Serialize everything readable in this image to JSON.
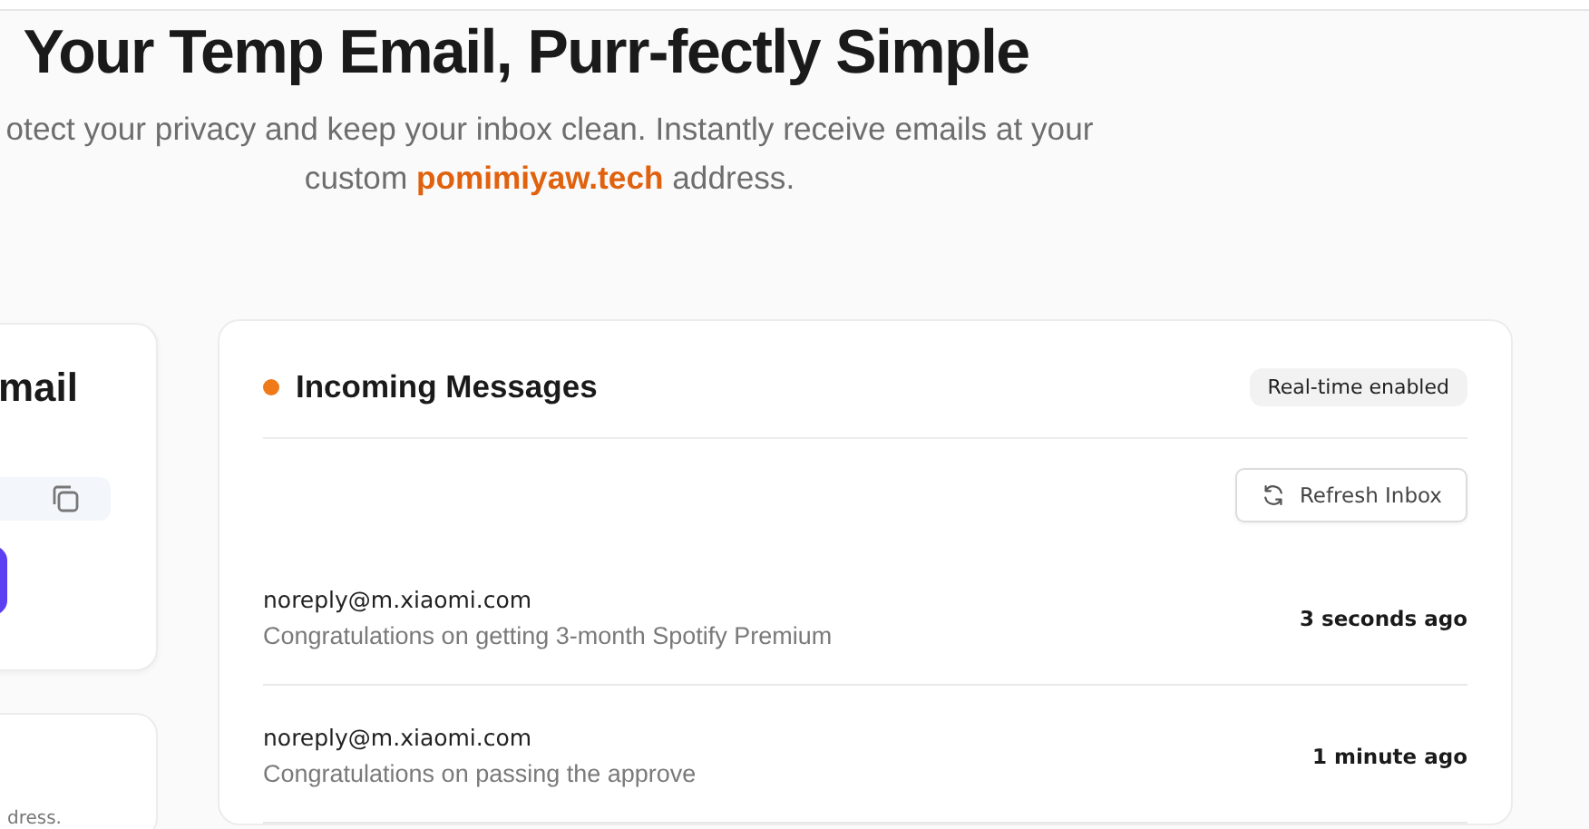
{
  "hero": {
    "title": "Your Temp Email, Purr-fectly Simple",
    "subtitle": "otect your privacy and keep your inbox clean. Instantly receive emails at your custom **pomimiyaw.tech** address."
  },
  "address_card": {
    "title": "mail"
  },
  "info_card": {
    "text": "dress."
  },
  "inbox": {
    "title": "Incoming Messages",
    "live": true,
    "badge": "Real-time enabled",
    "refresh_button": "Refresh Inbox",
    "messages": [
      {
        "sender": "noreply@m.xiaomi.com",
        "subject": "Congratulations on getting 3-month Spotify Premium",
        "time": "3 seconds ago"
      },
      {
        "sender": "noreply@m.xiaomi.com",
        "subject": "Congratulations on passing the approve",
        "time": "1 minute ago"
      }
    ]
  }
}
